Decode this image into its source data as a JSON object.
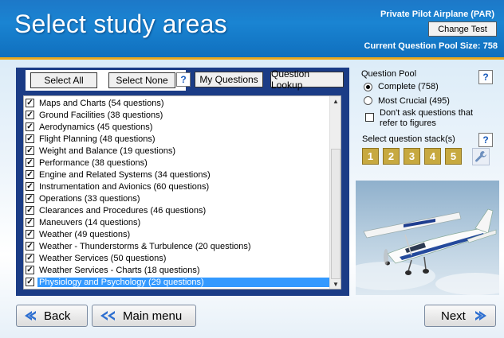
{
  "header": {
    "title": "Select study areas",
    "test_name": "Private Pilot Airplane (PAR)",
    "change_test_label": "Change Test",
    "pool_size_label": "Current Question Pool Size: 758"
  },
  "toolbar": {
    "select_all": "Select All",
    "select_none": "Select None",
    "help": "?",
    "my_questions": "My Questions",
    "question_lookup": "Question Lookup"
  },
  "study_areas": [
    {
      "label": "Maps and Charts (54 questions)",
      "checked": true
    },
    {
      "label": "Ground Facilities (38 questions)",
      "checked": true
    },
    {
      "label": "Aerodynamics (45 questions)",
      "checked": true
    },
    {
      "label": "Flight Planning (48 questions)",
      "checked": true
    },
    {
      "label": "Weight and Balance (19 questions)",
      "checked": true
    },
    {
      "label": "Performance (38 questions)",
      "checked": true
    },
    {
      "label": "Engine and Related Systems (34 questions)",
      "checked": true
    },
    {
      "label": "Instrumentation and Avionics (60 questions)",
      "checked": true
    },
    {
      "label": "Operations (33 questions)",
      "checked": true
    },
    {
      "label": "Clearances and Procedures (46 questions)",
      "checked": true
    },
    {
      "label": "Maneuvers (14 questions)",
      "checked": true
    },
    {
      "label": "Weather (49 questions)",
      "checked": true
    },
    {
      "label": "Weather - Thunderstorms & Turbulence (20 questions)",
      "checked": true
    },
    {
      "label": "Weather Services (50 questions)",
      "checked": true
    },
    {
      "label": "Weather Services - Charts (18 questions)",
      "checked": true
    },
    {
      "label": "Physiology and Psychology (29 questions)",
      "checked": true,
      "selected": true
    }
  ],
  "question_pool": {
    "title": "Question Pool",
    "help": "?",
    "options": [
      {
        "label": "Complete (758)",
        "selected": true
      },
      {
        "label": "Most Crucial (495)",
        "selected": false
      }
    ],
    "figures_line1": "Don't ask questions that",
    "figures_line2": "refer to figures",
    "figures_checked": false
  },
  "stacks": {
    "title": "Select question stack(s)",
    "help": "?",
    "buttons": [
      "1",
      "2",
      "3",
      "4",
      "5"
    ]
  },
  "nav": {
    "back": "Back",
    "main_menu": "Main menu",
    "next": "Next"
  },
  "colors": {
    "header_blue": "#1a84d2",
    "panel_navy": "#1b3c86",
    "accent_orange": "#e8a81f",
    "selection_blue": "#3399ff",
    "stack_gold": "#c7a940"
  }
}
